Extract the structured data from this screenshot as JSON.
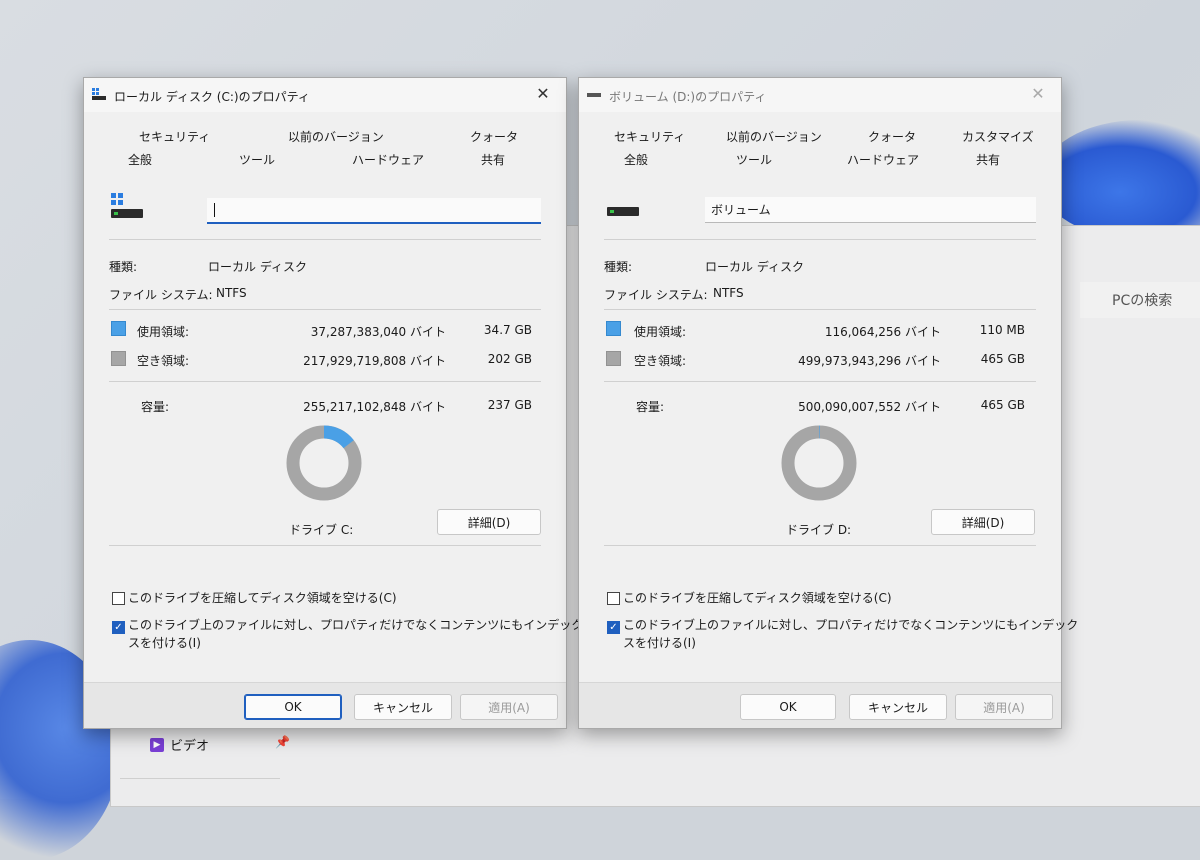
{
  "explorer": {
    "search_placeholder": "PCの検索",
    "sidebar_video": "ビデオ"
  },
  "dialog_c": {
    "title": "ローカル ディスク (C:)のプロパティ",
    "tabs_top": [
      "セキュリティ",
      "以前のバージョン",
      "クォータ"
    ],
    "tabs_bottom": [
      "全般",
      "ツール",
      "ハードウェア",
      "共有"
    ],
    "name_value": "",
    "type_label": "種類:",
    "type_value": "ローカル ディスク",
    "fs_label": "ファイル システム:",
    "fs_value": "NTFS",
    "used_label": "使用領域:",
    "used_bytes": "37,287,383,040 バイト",
    "used_size": "34.7 GB",
    "free_label": "空き領域:",
    "free_bytes": "217,929,719,808 バイト",
    "free_size": "202 GB",
    "capacity_label": "容量:",
    "capacity_bytes": "255,217,102,848 バイト",
    "capacity_size": "237 GB",
    "used_fraction": 0.146,
    "drive_label": "ドライブ C:",
    "details_button": "詳細(D)",
    "compress_label": "このドライブを圧縮してディスク領域を空ける(C)",
    "compress_checked": false,
    "index_label_line1": "このドライブ上のファイルに対し、プロパティだけでなくコンテンツにもインデックス",
    "index_label_line2": "スを付ける(I)",
    "index_checked": true,
    "ok_button": "OK",
    "cancel_button": "キャンセル",
    "apply_button": "適用(A)"
  },
  "dialog_d": {
    "title": "ボリューム (D:)のプロパティ",
    "tabs_top": [
      "セキュリティ",
      "以前のバージョン",
      "クォータ",
      "カスタマイズ"
    ],
    "tabs_bottom": [
      "全般",
      "ツール",
      "ハードウェア",
      "共有"
    ],
    "name_value": "ボリューム",
    "type_label": "種類:",
    "type_value": "ローカル ディスク",
    "fs_label": "ファイル システム:",
    "fs_value": "NTFS",
    "used_label": "使用領域:",
    "used_bytes": "116,064,256 バイト",
    "used_size": "110 MB",
    "free_label": "空き領域:",
    "free_bytes": "499,973,943,296 バイト",
    "free_size": "465 GB",
    "capacity_label": "容量:",
    "capacity_bytes": "500,090,007,552 バイト",
    "capacity_size": "465 GB",
    "used_fraction": 0.0002,
    "drive_label": "ドライブ D:",
    "details_button": "詳細(D)",
    "compress_label": "このドライブを圧縮してディスク領域を空ける(C)",
    "compress_checked": false,
    "index_label_line1": "このドライブ上のファイルに対し、プロパティだけでなくコンテンツにもインデック",
    "index_label_line2": "スを付ける(I)",
    "index_checked": true,
    "ok_button": "OK",
    "cancel_button": "キャンセル",
    "apply_button": "適用(A)"
  },
  "colors": {
    "used": "#4aa0e6",
    "free": "#a6a6a6",
    "accent": "#1f5fbf"
  },
  "icons": {
    "drive": "hard-drive-icon",
    "windows": "windows-logo-icon",
    "close": "close-icon",
    "video": "video-folder-icon",
    "pin": "pin-icon"
  }
}
